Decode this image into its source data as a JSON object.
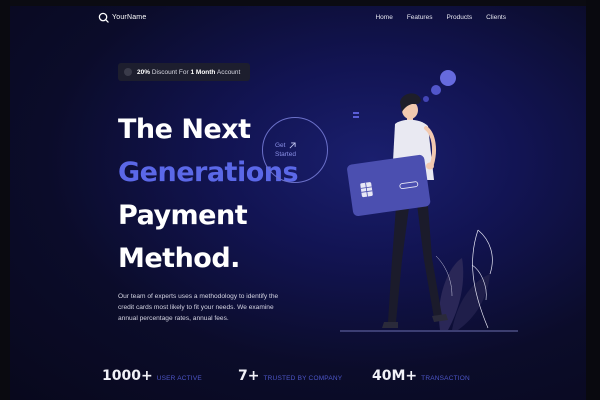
{
  "nav": {
    "logo_text": "YourName",
    "links": [
      "Home",
      "Features",
      "Products",
      "Clients"
    ]
  },
  "badge": {
    "highlight": "20%",
    "text": " Discount For ",
    "highlight2": "1 Month",
    "text2": " Account"
  },
  "headline": {
    "line1": "The Next",
    "line2": "Generations",
    "line3": "Payment",
    "line4": "Method."
  },
  "cta": {
    "line1": "Get",
    "line2": "Started"
  },
  "description": "Our team of experts uses a methodology to identify the credit cards most likely to fit your needs. We examine annual percentage rates, annual fees.",
  "stats": [
    {
      "number": "1000+",
      "label": "USER ACTIVE"
    },
    {
      "number": "7+",
      "label": "TRUSTED BY COMPANY"
    },
    {
      "number": "40M+",
      "label": "TRANSACTION"
    }
  ],
  "colors": {
    "accent": "#5b68e8",
    "background": "#0b0c2a",
    "card": "#4b4fb0"
  },
  "icons": {
    "logo": "search-circle-icon",
    "cta_arrow": "arrow-up-right-icon",
    "badge": "dot-icon"
  }
}
